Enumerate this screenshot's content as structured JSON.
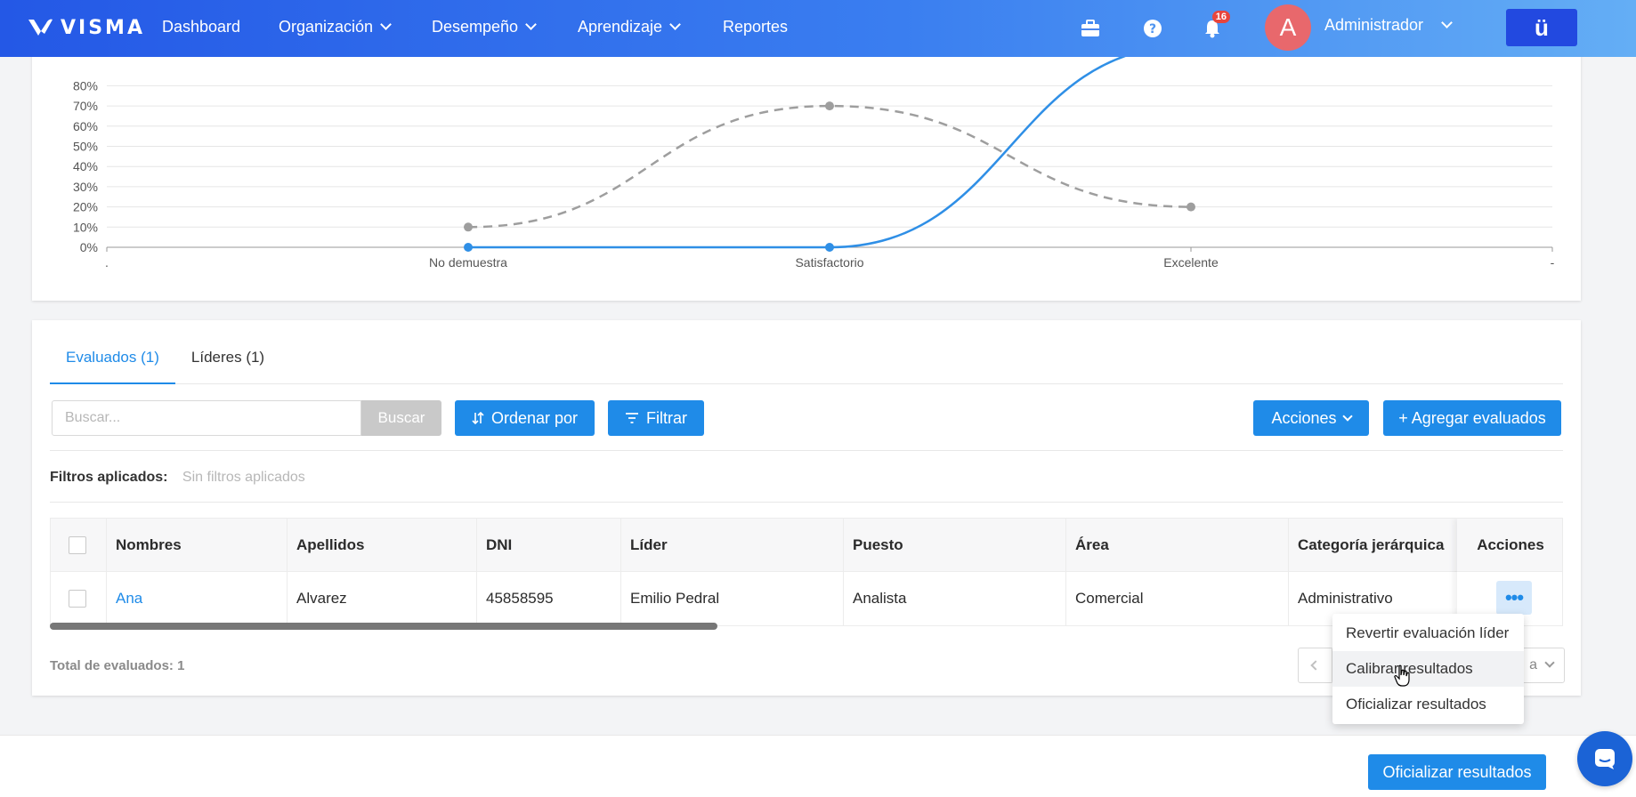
{
  "brand": {
    "logo_text": "VISMA"
  },
  "nav": {
    "items": [
      {
        "label": "Dashboard",
        "has_dropdown": false
      },
      {
        "label": "Organización",
        "has_dropdown": true
      },
      {
        "label": "Desempeño",
        "has_dropdown": true
      },
      {
        "label": "Aprendizaje",
        "has_dropdown": true
      },
      {
        "label": "Reportes",
        "has_dropdown": false
      }
    ],
    "notifications_count": "16",
    "user_initial": "A",
    "user_name": "Administrador",
    "app_button_label": "ü"
  },
  "chart_data": {
    "type": "line",
    "categories": [
      "No demuestra",
      "Satisfactorio",
      "Excelente"
    ],
    "x_edge_labels": [
      ".",
      "-"
    ],
    "y_tick_labels": [
      "0%",
      "10%",
      "20%",
      "30%",
      "40%",
      "50%",
      "60%",
      "70%",
      "80%"
    ],
    "ylim": [
      0,
      80
    ],
    "grid": true,
    "series": [
      {
        "style": "dashed",
        "color": "#9e9e9e",
        "values": [
          10,
          70,
          20
        ]
      },
      {
        "style": "solid",
        "color": "#2f8fe6",
        "values": [
          0,
          0,
          100
        ]
      }
    ]
  },
  "tabs": [
    {
      "label": "Evaluados (1)",
      "active": true
    },
    {
      "label": "Líderes (1)",
      "active": false
    }
  ],
  "toolbar": {
    "search_placeholder": "Buscar...",
    "search_button": "Buscar",
    "sort_button": "Ordenar por",
    "filter_button": "Filtrar",
    "actions_button": "Acciones",
    "add_button": "+ Agregar evaluados"
  },
  "filters": {
    "label": "Filtros aplicados:",
    "value": "Sin filtros aplicados"
  },
  "table": {
    "columns": [
      "Nombres",
      "Apellidos",
      "DNI",
      "Líder",
      "Puesto",
      "Área",
      "Categoría jerárquica",
      "Acciones"
    ],
    "rows": [
      {
        "nombres": "Ana",
        "apellidos": "Alvarez",
        "dni": "45858595",
        "lider": "Emilio Pedral",
        "puesto": "Analista",
        "area": "Comercial",
        "categoria": "Administrativo"
      }
    ]
  },
  "total_label": "Total de evaluados: 1",
  "pager": {
    "partial_text": "a"
  },
  "row_menu": {
    "items": [
      "Revertir evaluación líder",
      "Calibrar resultados",
      "Oficializar resultados"
    ],
    "hovered_index": 1
  },
  "footer": {
    "primary_button": "Oficializar resultados"
  },
  "colors": {
    "accent": "#1f8be8",
    "nav_start": "#2458e6",
    "nav_end": "#64aef5",
    "badge": "#e8453c",
    "avatar": "#e8686c"
  }
}
